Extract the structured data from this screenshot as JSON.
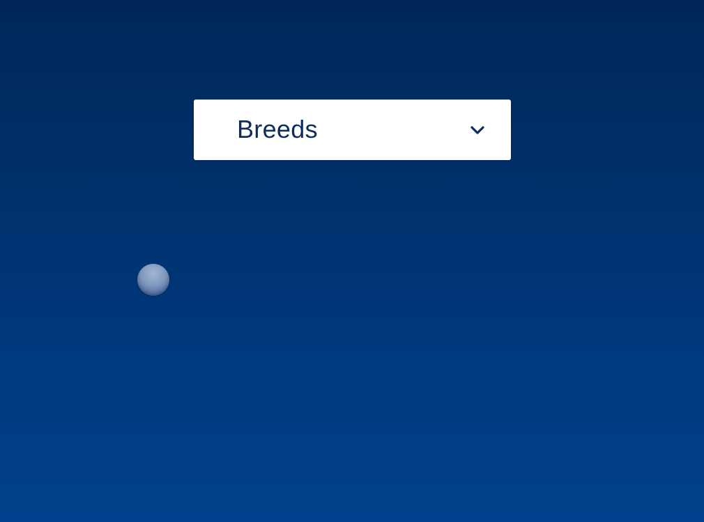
{
  "dropdown": {
    "label": "Breeds",
    "icon": "chevron-down-icon"
  },
  "indicator": {
    "icon": "orb-icon"
  },
  "colors": {
    "background_top": "#002658",
    "background_bottom": "#00408c",
    "dropdown_bg": "#ffffff",
    "text": "#0d2d5c"
  }
}
